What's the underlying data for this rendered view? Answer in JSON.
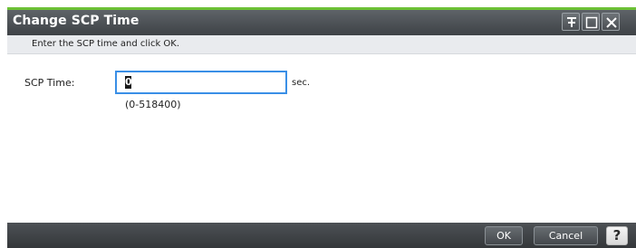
{
  "dialog": {
    "title": "Change SCP Time",
    "instruction": "Enter the SCP time and click OK.",
    "window_controls": [
      "pin-icon",
      "maximize-icon",
      "close-icon"
    ]
  },
  "form": {
    "scp_time_label": "SCP Time:",
    "scp_time_value": "0",
    "unit": "sec.",
    "range_hint": "(0-518400)"
  },
  "footer": {
    "ok_label": "OK",
    "cancel_label": "Cancel",
    "help_label": "?"
  },
  "colors": {
    "accent": "#6cc035",
    "titlebar": "#4a4e52",
    "input_focus_border": "#3a8fe6",
    "instruction_band": "#e9ebee"
  }
}
